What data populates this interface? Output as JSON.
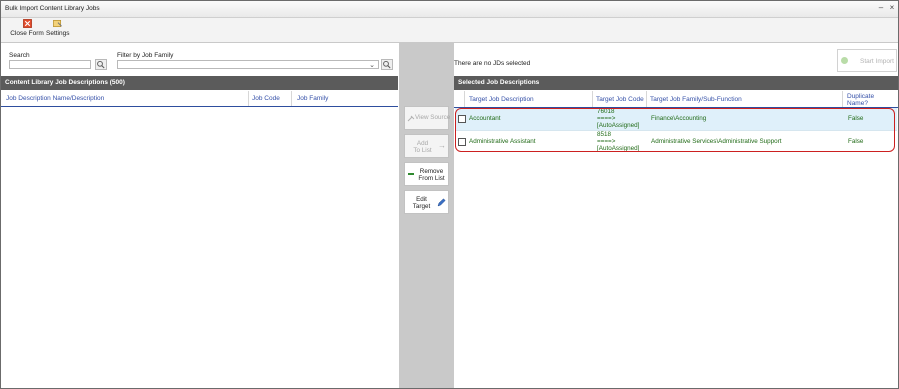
{
  "window": {
    "title": "Bulk Import Content Library Jobs"
  },
  "toolbar": {
    "close_form": "Close Form",
    "settings": "Settings"
  },
  "left": {
    "search_label": "Search",
    "filter_label": "Filter by Job Family",
    "panel_title": "Content Library Job Descriptions (500)",
    "columns": [
      "Job Description Name/Description",
      "Job Code",
      "Job Family"
    ]
  },
  "middle": {
    "view_source": "View Source",
    "add_to_list": [
      "Add",
      "To List"
    ],
    "remove_from_list": [
      "Remove",
      "From List"
    ],
    "edit_target": [
      "Edit",
      "Target"
    ]
  },
  "right": {
    "status": "There are no JDs selected",
    "start_import": "Start Import",
    "panel_title": "Selected Job Descriptions",
    "columns": [
      "Target Job Description",
      "Target Job Code",
      "Target Job Family/Sub-Function",
      "Duplicate",
      "Name?"
    ],
    "rows": [
      {
        "description": "Accountant",
        "code": "76018",
        "arrow": "====>",
        "assigned": "[AutoAssigned]",
        "family": "Finance\\Accounting",
        "duplicate": "False"
      },
      {
        "description": "Administrative Assistant",
        "code": "8518",
        "arrow": "====>",
        "assigned": "[AutoAssigned]",
        "family": "Administrative Services\\Administrative Support",
        "duplicate": "False"
      }
    ]
  },
  "colors": {
    "header_bar": "#5b5b5b",
    "link_blue": "#3550a8",
    "row_green": "#226b18",
    "selected_row": "#dff0fa",
    "highlight_red": "#cc2020"
  }
}
